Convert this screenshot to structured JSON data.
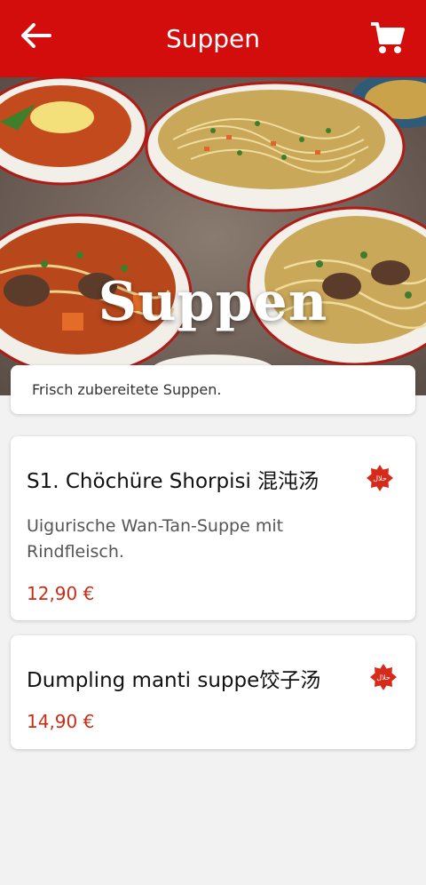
{
  "header": {
    "title": "Suppen",
    "back_icon": "arrow-left-icon",
    "cart_icon": "shopping-cart-icon",
    "background": "#d30c0c"
  },
  "hero": {
    "overlay_text": "Suppen"
  },
  "category": {
    "description": "Frisch zubereitete Suppen."
  },
  "items": [
    {
      "name": "S1. Chöchüre Shorpisi 混沌汤",
      "description": "Uigurische Wan-Tan-Suppe mit Rindfleisch.",
      "price": "12,90 €",
      "badge": "حلال",
      "badge_icon": "halal-badge-icon"
    },
    {
      "name": "Dumpling manti suppe饺子汤",
      "description": "",
      "price": "14,90 €",
      "badge": "حلال",
      "badge_icon": "halal-badge-icon"
    }
  ],
  "colors": {
    "accent": "#d30c0c",
    "price": "#c82d17",
    "badge": "#d62a1a"
  }
}
